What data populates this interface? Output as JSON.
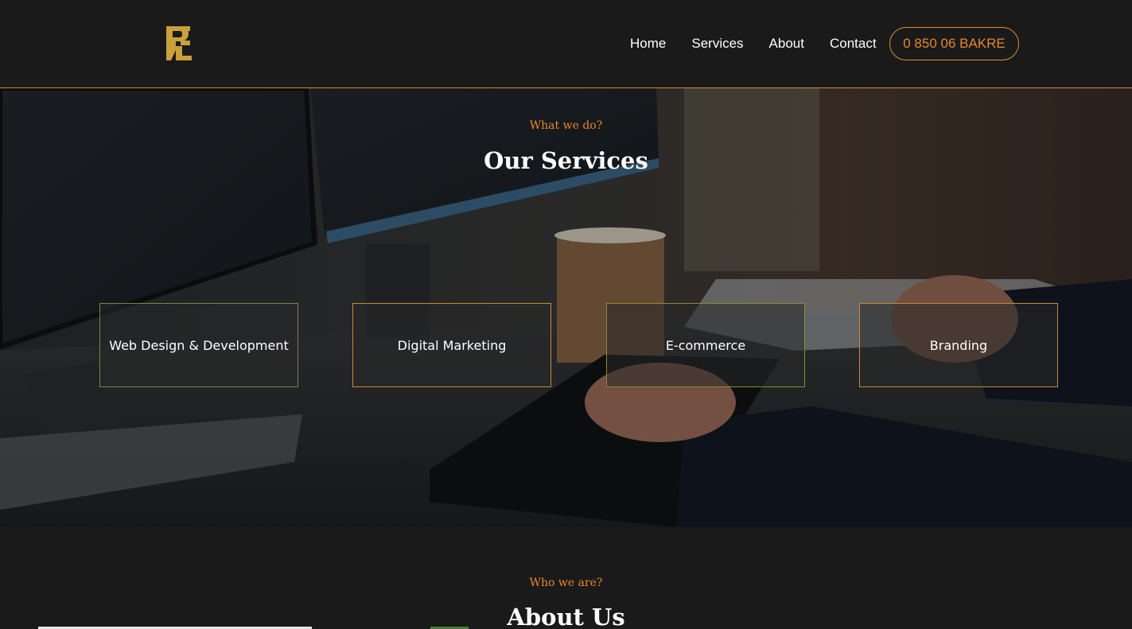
{
  "header": {
    "logo_icon": "re-monogram-logo",
    "nav": [
      {
        "label": "Home"
      },
      {
        "label": "Services"
      },
      {
        "label": "About"
      },
      {
        "label": "Contact"
      }
    ],
    "phone_label": "0 850 06 BAKRE"
  },
  "hero": {
    "kicker": "What we do?",
    "title": "Our Services",
    "services": [
      {
        "label": "Web Design & Development"
      },
      {
        "label": "Digital Marketing"
      },
      {
        "label": "E-commerce"
      },
      {
        "label": "Branding"
      }
    ]
  },
  "about": {
    "kicker": "Who we are?",
    "title": "About Us"
  },
  "colors": {
    "accent": "#e8862a",
    "logo": "#c9a03a",
    "background": "#1a1a1a"
  }
}
